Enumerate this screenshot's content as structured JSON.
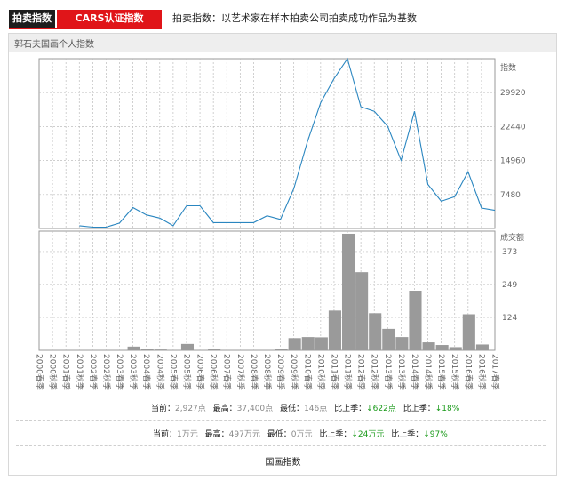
{
  "tabs": {
    "active": "拍卖指数",
    "secondary": "CARS认证指数"
  },
  "description": "拍卖指数：以艺术家在样本拍卖公司拍卖成功作品为基数",
  "panel": {
    "title": "郭石夫国画个人指数"
  },
  "chart_data": [
    {
      "type": "line",
      "ylabel": "指数",
      "ylim": [
        0,
        37400
      ],
      "yticks": [
        7480,
        14960,
        22440,
        29920
      ],
      "x": [
        "2000春季",
        "2000秋季",
        "2001春季",
        "2001秋季",
        "2002春季",
        "2002秋季",
        "2003春季",
        "2003秋季",
        "2004春季",
        "2004秋季",
        "2005春季",
        "2005秋季",
        "2006春季",
        "2006秋季",
        "2007春季",
        "2007秋季",
        "2008春季",
        "2008秋季",
        "2009春季",
        "2009秋季",
        "2010春季",
        "2010秋季",
        "2011春季",
        "2011秋季",
        "2012春季",
        "2012秋季",
        "2013春季",
        "2013秋季",
        "2014春季",
        "2014秋季",
        "2015春季",
        "2015秋季",
        "2016春季",
        "2016秋季",
        "2017春季"
      ],
      "values": [
        null,
        null,
        null,
        600,
        300,
        300,
        1200,
        4600,
        3000,
        2300,
        600,
        5000,
        5000,
        1300,
        1300,
        1300,
        1300,
        2800,
        2000,
        8800,
        19000,
        27700,
        33000,
        37400,
        26800,
        25800,
        22500,
        15000,
        25800,
        9700,
        6000,
        7000,
        12500,
        4500,
        4000
      ]
    },
    {
      "type": "bar",
      "ylabel": "成交额",
      "ylim": [
        0,
        450
      ],
      "yticks": [
        124,
        249,
        373
      ],
      "x": [
        "2000春季",
        "2000秋季",
        "2001春季",
        "2001秋季",
        "2002春季",
        "2002秋季",
        "2003春季",
        "2003秋季",
        "2004春季",
        "2004秋季",
        "2005春季",
        "2005秋季",
        "2006春季",
        "2006秋季",
        "2007春季",
        "2007秋季",
        "2008春季",
        "2008秋季",
        "2009春季",
        "2009秋季",
        "2010春季",
        "2010秋季",
        "2011春季",
        "2011秋季",
        "2012春季",
        "2012秋季",
        "2013春季",
        "2013秋季",
        "2014春季",
        "2014秋季",
        "2015春季",
        "2015秋季",
        "2016春季",
        "2016秋季",
        "2017春季"
      ],
      "values": [
        0,
        0,
        0,
        0,
        0,
        0,
        0,
        14,
        6,
        3,
        0,
        24,
        0,
        5,
        0,
        0,
        0,
        0,
        5,
        46,
        50,
        49,
        150,
        440,
        295,
        140,
        81,
        50,
        225,
        30,
        20,
        12,
        136,
        22,
        0
      ]
    }
  ],
  "stats_index": {
    "current_label": "当前：",
    "current": "2,927点",
    "high_label": "最高：",
    "high": "37,400点",
    "low_label": "最低：",
    "low": "146点",
    "change1_label": "比上季：",
    "change1": "↓622点",
    "change2_label": "比上季：",
    "change2": "↓18%"
  },
  "stats_turnover": {
    "current_label": "当前：",
    "current": "1万元",
    "high_label": "最高：",
    "high": "497万元",
    "low_label": "最低：",
    "low": "0万元",
    "change1_label": "比上季：",
    "change1": "↓24万元",
    "change2_label": "比上季：",
    "change2": "↓97%"
  },
  "footer": {
    "title": "国画指数"
  },
  "colors": {
    "line": "#2a86c0",
    "bar": "#9a9a9a",
    "grid": "#bdbdbd",
    "axis": "#999999",
    "green": "#1a9a1a",
    "red": "#e01519"
  }
}
